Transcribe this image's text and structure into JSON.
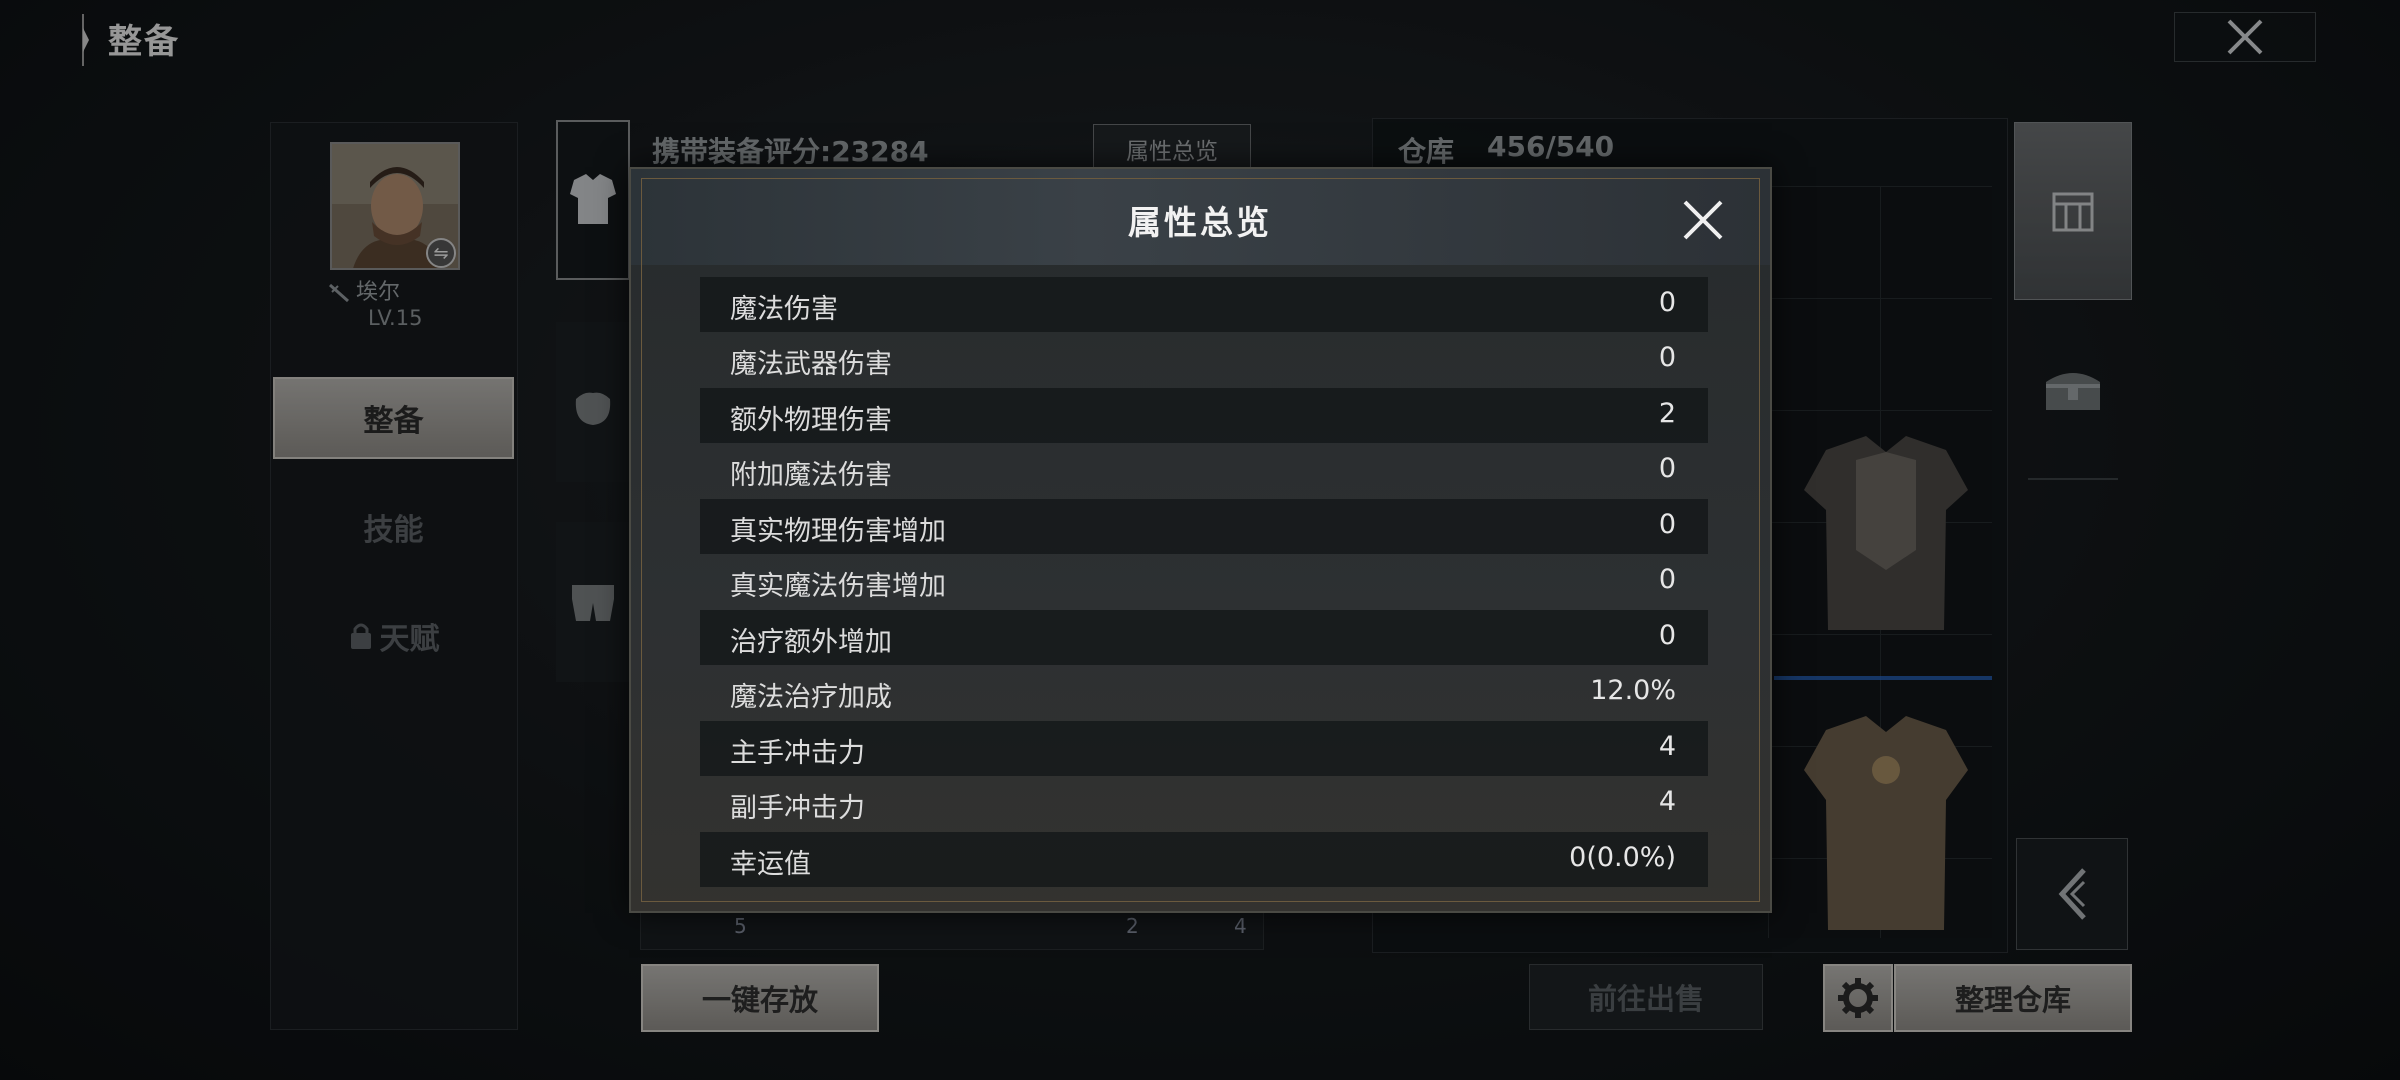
{
  "header": {
    "title": "整备"
  },
  "character": {
    "name": "埃尔",
    "level": "LV.15"
  },
  "nav": {
    "equip": "整备",
    "skills": "技能",
    "talent": "天赋"
  },
  "equipment": {
    "score_label": "携带装备评分:23284",
    "attr_button": "属性总览"
  },
  "mid_strip": {
    "num_a": "5",
    "num_b": "2",
    "num_c": "4"
  },
  "buttons": {
    "store_all": "一键存放",
    "go_sell": "前往出售",
    "sort_warehouse": "整理仓库"
  },
  "warehouse": {
    "title": "仓库",
    "count": "456/540"
  },
  "modal": {
    "title": "属性总览",
    "rows": [
      {
        "label": "魔法伤害",
        "value": "0"
      },
      {
        "label": "魔法武器伤害",
        "value": "0"
      },
      {
        "label": "额外物理伤害",
        "value": "2"
      },
      {
        "label": "附加魔法伤害",
        "value": "0"
      },
      {
        "label": "真实物理伤害增加",
        "value": "0"
      },
      {
        "label": "真实魔法伤害增加",
        "value": "0"
      },
      {
        "label": "治疗额外增加",
        "value": "0"
      },
      {
        "label": "魔法治疗加成",
        "value": "12.0%"
      },
      {
        "label": "主手冲击力",
        "value": "4"
      },
      {
        "label": "副手冲击力",
        "value": "4"
      },
      {
        "label": "幸运值",
        "value": "0(0.0%)"
      }
    ]
  },
  "colors": {
    "accent_blue": "#2b6fd6",
    "modal_border": "#6b5a3e"
  }
}
